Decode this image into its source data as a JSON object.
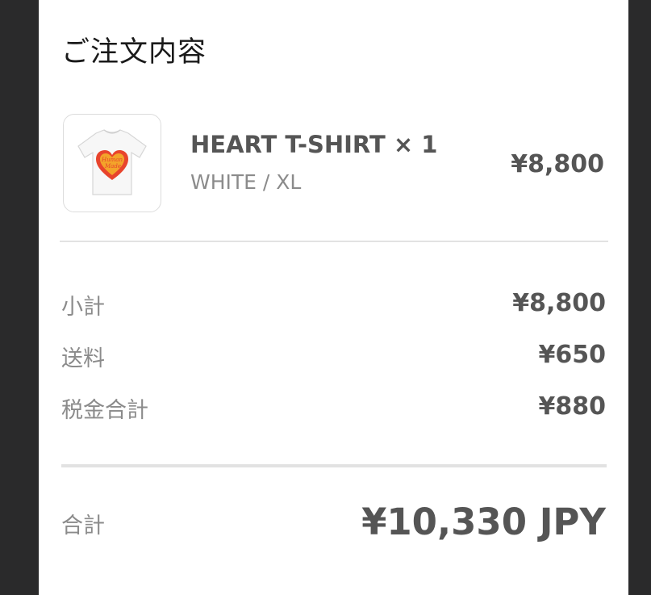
{
  "order": {
    "title": "ご注文内容",
    "item": {
      "name": "HEART T-SHIRT × 1",
      "variant": "WHITE / XL",
      "price": "¥8,800",
      "image_text": "Human Made",
      "image_icon": "heart-tshirt-icon"
    },
    "summary": [
      {
        "label": "小計",
        "value": "¥8,800"
      },
      {
        "label": "送料",
        "value": "¥650"
      },
      {
        "label": "税金合計",
        "value": "¥880"
      }
    ],
    "total": {
      "label": "合計",
      "value": "¥10,330 JPY"
    }
  },
  "colors": {
    "page_background": "#2a2a2b",
    "card_background": "#ffffff",
    "text_dark": "#555555",
    "text_muted": "#8b8b8b",
    "divider": "#e2e2e2",
    "heart_red": "#e8442c",
    "heart_yellow": "#f4b52a"
  }
}
